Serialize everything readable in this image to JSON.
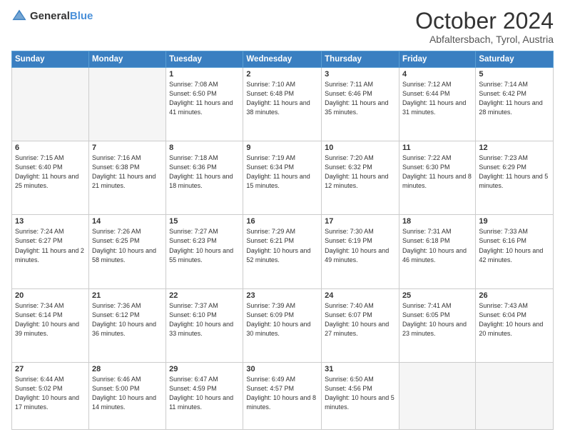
{
  "header": {
    "logo_general": "General",
    "logo_blue": "Blue",
    "month_title": "October 2024",
    "location": "Abfaltersbach, Tyrol, Austria"
  },
  "days_of_week": [
    "Sunday",
    "Monday",
    "Tuesday",
    "Wednesday",
    "Thursday",
    "Friday",
    "Saturday"
  ],
  "weeks": [
    [
      {
        "day": "",
        "sunrise": "",
        "sunset": "",
        "daylight": "",
        "empty": true
      },
      {
        "day": "",
        "sunrise": "",
        "sunset": "",
        "daylight": "",
        "empty": true
      },
      {
        "day": "1",
        "sunrise": "Sunrise: 7:08 AM",
        "sunset": "Sunset: 6:50 PM",
        "daylight": "Daylight: 11 hours and 41 minutes."
      },
      {
        "day": "2",
        "sunrise": "Sunrise: 7:10 AM",
        "sunset": "Sunset: 6:48 PM",
        "daylight": "Daylight: 11 hours and 38 minutes."
      },
      {
        "day": "3",
        "sunrise": "Sunrise: 7:11 AM",
        "sunset": "Sunset: 6:46 PM",
        "daylight": "Daylight: 11 hours and 35 minutes."
      },
      {
        "day": "4",
        "sunrise": "Sunrise: 7:12 AM",
        "sunset": "Sunset: 6:44 PM",
        "daylight": "Daylight: 11 hours and 31 minutes."
      },
      {
        "day": "5",
        "sunrise": "Sunrise: 7:14 AM",
        "sunset": "Sunset: 6:42 PM",
        "daylight": "Daylight: 11 hours and 28 minutes."
      }
    ],
    [
      {
        "day": "6",
        "sunrise": "Sunrise: 7:15 AM",
        "sunset": "Sunset: 6:40 PM",
        "daylight": "Daylight: 11 hours and 25 minutes."
      },
      {
        "day": "7",
        "sunrise": "Sunrise: 7:16 AM",
        "sunset": "Sunset: 6:38 PM",
        "daylight": "Daylight: 11 hours and 21 minutes."
      },
      {
        "day": "8",
        "sunrise": "Sunrise: 7:18 AM",
        "sunset": "Sunset: 6:36 PM",
        "daylight": "Daylight: 11 hours and 18 minutes."
      },
      {
        "day": "9",
        "sunrise": "Sunrise: 7:19 AM",
        "sunset": "Sunset: 6:34 PM",
        "daylight": "Daylight: 11 hours and 15 minutes."
      },
      {
        "day": "10",
        "sunrise": "Sunrise: 7:20 AM",
        "sunset": "Sunset: 6:32 PM",
        "daylight": "Daylight: 11 hours and 12 minutes."
      },
      {
        "day": "11",
        "sunrise": "Sunrise: 7:22 AM",
        "sunset": "Sunset: 6:30 PM",
        "daylight": "Daylight: 11 hours and 8 minutes."
      },
      {
        "day": "12",
        "sunrise": "Sunrise: 7:23 AM",
        "sunset": "Sunset: 6:29 PM",
        "daylight": "Daylight: 11 hours and 5 minutes."
      }
    ],
    [
      {
        "day": "13",
        "sunrise": "Sunrise: 7:24 AM",
        "sunset": "Sunset: 6:27 PM",
        "daylight": "Daylight: 11 hours and 2 minutes."
      },
      {
        "day": "14",
        "sunrise": "Sunrise: 7:26 AM",
        "sunset": "Sunset: 6:25 PM",
        "daylight": "Daylight: 10 hours and 58 minutes."
      },
      {
        "day": "15",
        "sunrise": "Sunrise: 7:27 AM",
        "sunset": "Sunset: 6:23 PM",
        "daylight": "Daylight: 10 hours and 55 minutes."
      },
      {
        "day": "16",
        "sunrise": "Sunrise: 7:29 AM",
        "sunset": "Sunset: 6:21 PM",
        "daylight": "Daylight: 10 hours and 52 minutes."
      },
      {
        "day": "17",
        "sunrise": "Sunrise: 7:30 AM",
        "sunset": "Sunset: 6:19 PM",
        "daylight": "Daylight: 10 hours and 49 minutes."
      },
      {
        "day": "18",
        "sunrise": "Sunrise: 7:31 AM",
        "sunset": "Sunset: 6:18 PM",
        "daylight": "Daylight: 10 hours and 46 minutes."
      },
      {
        "day": "19",
        "sunrise": "Sunrise: 7:33 AM",
        "sunset": "Sunset: 6:16 PM",
        "daylight": "Daylight: 10 hours and 42 minutes."
      }
    ],
    [
      {
        "day": "20",
        "sunrise": "Sunrise: 7:34 AM",
        "sunset": "Sunset: 6:14 PM",
        "daylight": "Daylight: 10 hours and 39 minutes."
      },
      {
        "day": "21",
        "sunrise": "Sunrise: 7:36 AM",
        "sunset": "Sunset: 6:12 PM",
        "daylight": "Daylight: 10 hours and 36 minutes."
      },
      {
        "day": "22",
        "sunrise": "Sunrise: 7:37 AM",
        "sunset": "Sunset: 6:10 PM",
        "daylight": "Daylight: 10 hours and 33 minutes."
      },
      {
        "day": "23",
        "sunrise": "Sunrise: 7:39 AM",
        "sunset": "Sunset: 6:09 PM",
        "daylight": "Daylight: 10 hours and 30 minutes."
      },
      {
        "day": "24",
        "sunrise": "Sunrise: 7:40 AM",
        "sunset": "Sunset: 6:07 PM",
        "daylight": "Daylight: 10 hours and 27 minutes."
      },
      {
        "day": "25",
        "sunrise": "Sunrise: 7:41 AM",
        "sunset": "Sunset: 6:05 PM",
        "daylight": "Daylight: 10 hours and 23 minutes."
      },
      {
        "day": "26",
        "sunrise": "Sunrise: 7:43 AM",
        "sunset": "Sunset: 6:04 PM",
        "daylight": "Daylight: 10 hours and 20 minutes."
      }
    ],
    [
      {
        "day": "27",
        "sunrise": "Sunrise: 6:44 AM",
        "sunset": "Sunset: 5:02 PM",
        "daylight": "Daylight: 10 hours and 17 minutes."
      },
      {
        "day": "28",
        "sunrise": "Sunrise: 6:46 AM",
        "sunset": "Sunset: 5:00 PM",
        "daylight": "Daylight: 10 hours and 14 minutes."
      },
      {
        "day": "29",
        "sunrise": "Sunrise: 6:47 AM",
        "sunset": "Sunset: 4:59 PM",
        "daylight": "Daylight: 10 hours and 11 minutes."
      },
      {
        "day": "30",
        "sunrise": "Sunrise: 6:49 AM",
        "sunset": "Sunset: 4:57 PM",
        "daylight": "Daylight: 10 hours and 8 minutes."
      },
      {
        "day": "31",
        "sunrise": "Sunrise: 6:50 AM",
        "sunset": "Sunset: 4:56 PM",
        "daylight": "Daylight: 10 hours and 5 minutes."
      },
      {
        "day": "",
        "sunrise": "",
        "sunset": "",
        "daylight": "",
        "empty": true
      },
      {
        "day": "",
        "sunrise": "",
        "sunset": "",
        "daylight": "",
        "empty": true
      }
    ]
  ]
}
